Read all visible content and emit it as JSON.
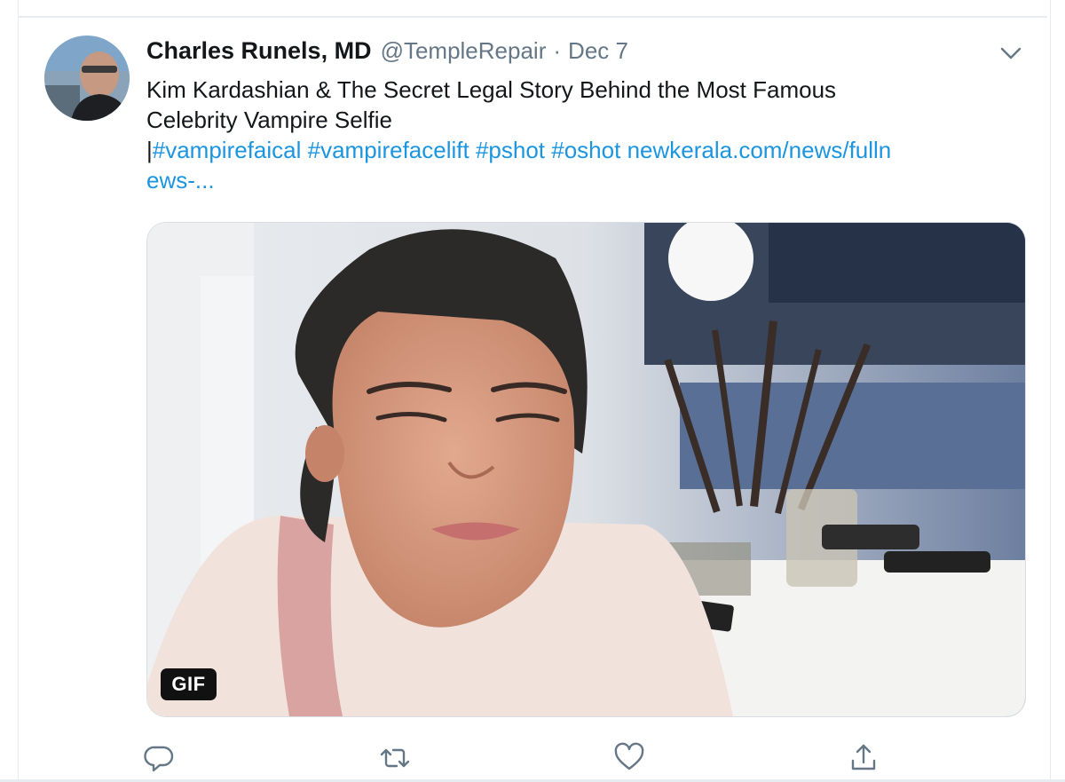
{
  "tweet": {
    "author_name": "Charles Runels, MD",
    "handle": "@TempleRepair",
    "separator": "·",
    "date": "Dec 7",
    "text_line1": "Kim Kardashian & The Secret Legal Story Behind the Most Famous",
    "text_line2": "Celebrity Vampire Selfie",
    "pipe": "|",
    "hashtags": [
      "#vampirefaical",
      "#vampirefacelift",
      "#pshot",
      "#oshot"
    ],
    "link_part1": "newkerala.com/news/fulln",
    "link_part2": "ews-...",
    "media_badge": "GIF"
  },
  "icons": {
    "caret": "chevron-down-icon",
    "reply": "reply-icon",
    "retweet": "retweet-icon",
    "like": "heart-icon",
    "share": "share-icon"
  },
  "colors": {
    "text": "#14171a",
    "secondary": "#657786",
    "link": "#1b95e0",
    "border": "#e6ecf0"
  }
}
